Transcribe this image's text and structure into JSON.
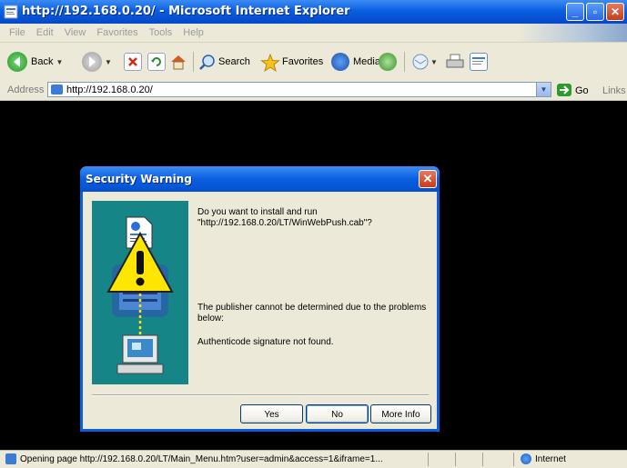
{
  "window": {
    "title": "http://192.168.0.20/ - Microsoft Internet Explorer",
    "minimize": "_",
    "maximize": "▫",
    "close": "✕"
  },
  "menu": [
    "File",
    "Edit",
    "View",
    "Favorites",
    "Tools",
    "Help"
  ],
  "toolbar": {
    "back": "Back",
    "search": "Search",
    "favorites": "Favorites",
    "media": "Media"
  },
  "address": {
    "label": "Address",
    "value": "http://192.168.0.20/",
    "go": "Go",
    "links": "Links"
  },
  "status": {
    "text": "Opening page http://192.168.0.20/LT/Main_Menu.htm?user=admin&access=1&iframe=1...",
    "zone": "Internet"
  },
  "dialog": {
    "title": "Security Warning",
    "close": "✕",
    "question": "Do you want to install and run \"http://192.168.0.20/LT/WinWebPush.cab\"?",
    "publisher": "The publisher cannot be determined due to the problems below:",
    "auth": "Authenticode signature not found.",
    "yes": "Yes",
    "no": "No",
    "more_info": "More Info"
  },
  "colors": {
    "xp_blue": "#0a5fe0",
    "warning_panel": "#168587",
    "warning_yellow": "#ffe600"
  }
}
